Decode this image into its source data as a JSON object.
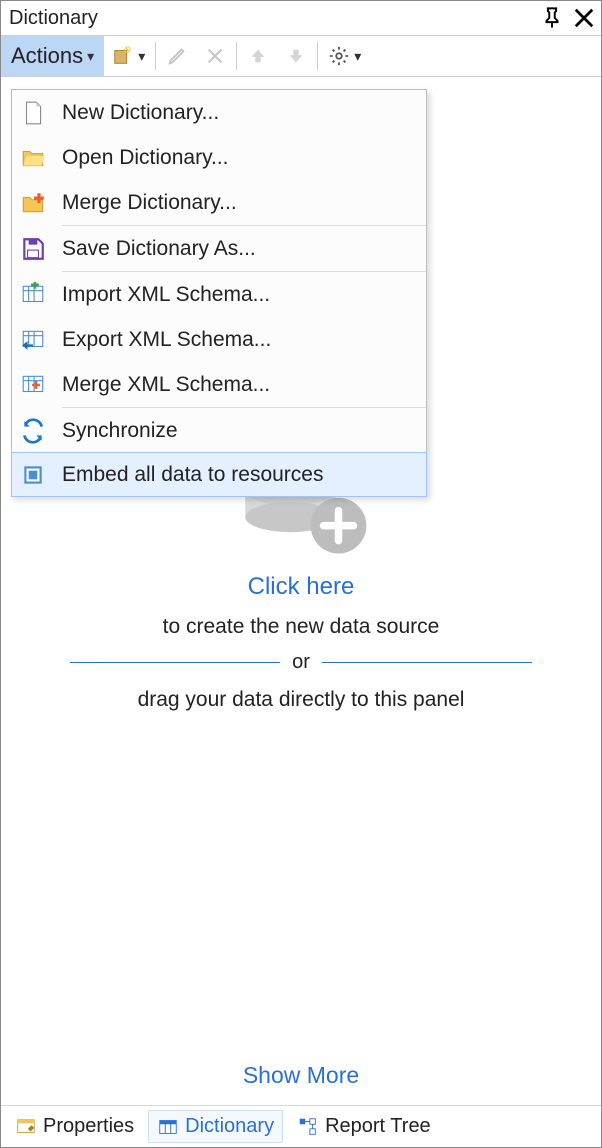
{
  "titlebar": {
    "title": "Dictionary"
  },
  "toolbar": {
    "actions_label": "Actions"
  },
  "menu": {
    "items": [
      {
        "label": "New Dictionary..."
      },
      {
        "label": "Open Dictionary..."
      },
      {
        "label": "Merge Dictionary..."
      },
      {
        "label": "Save Dictionary As..."
      },
      {
        "label": "Import XML Schema..."
      },
      {
        "label": "Export XML Schema..."
      },
      {
        "label": "Merge XML Schema..."
      },
      {
        "label": "Synchronize"
      },
      {
        "label": "Embed all data to resources"
      }
    ]
  },
  "placeholder": {
    "link": "Click here",
    "line1": "to create the new data source",
    "or": "or",
    "line2": "drag your data directly to this panel",
    "show_more": "Show More"
  },
  "tabs": {
    "properties": "Properties",
    "dictionary": "Dictionary",
    "report_tree": "Report Tree"
  },
  "colors": {
    "accent": "#2a6fd6",
    "menu_highlight": "#e4efff"
  }
}
